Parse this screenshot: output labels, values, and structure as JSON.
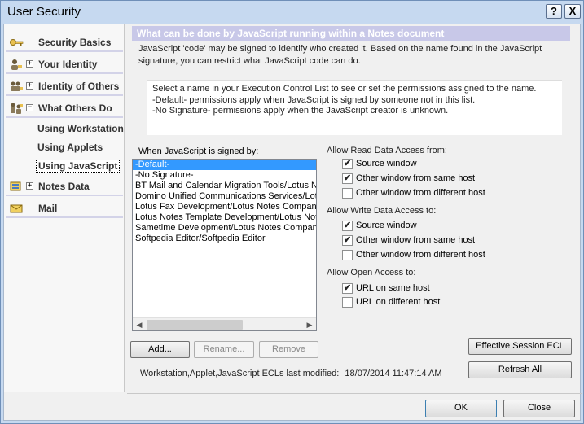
{
  "window": {
    "title": "User Security",
    "help_glyph": "?",
    "close_glyph": "X"
  },
  "sidebar": {
    "items": [
      {
        "label": "Security Basics",
        "icon": "key-icon"
      },
      {
        "label": "Your Identity",
        "icon": "person-icon",
        "expander": "+"
      },
      {
        "label": "Identity of Others",
        "icon": "people-icon",
        "expander": "+"
      },
      {
        "label": "What Others Do",
        "icon": "workers-icon",
        "expander": "−"
      },
      {
        "label": "Notes Data",
        "icon": "database-icon",
        "expander": "+"
      },
      {
        "label": "Mail",
        "icon": "envelope-icon"
      }
    ],
    "subitems": [
      {
        "label": "Using Workstation"
      },
      {
        "label": "Using Applets"
      },
      {
        "label": "Using JavaScript"
      }
    ]
  },
  "main": {
    "header": "What can be done by JavaScript running within a Notes document",
    "intro_line1": "JavaScript 'code' may be signed to identify who created it.  Based on the name found in the JavaScript",
    "intro_line2": "signature, you can restrict what JavaScript code can do.",
    "info_line1": "Select a name in your Execution Control List to see or set the permissions assigned to the name.",
    "info_line2": "-Default- permissions apply when JavaScript is signed by someone not in this list.",
    "info_line3": "-No Signature- permissions apply when the JavaScript creator is unknown.",
    "signed_label": "When JavaScript is signed by:",
    "ecl_items": [
      "-Default-",
      "-No Signature-",
      "BT Mail and Calendar Migration Tools/Lotus Notes",
      "Domino Unified Communications Services/Lotus Notes",
      "Lotus Fax Development/Lotus Notes Companion",
      "Lotus Notes Template Development/Lotus Notes",
      "Sametime Development/Lotus Notes Companion",
      "Softpedia Editor/Softpedia Editor"
    ],
    "add_button": "Add...",
    "rename_button": "Rename...",
    "remove_button": "Remove",
    "read_label": "Allow Read Data Access from:",
    "write_label": "Allow Write Data Access to:",
    "open_label": "Allow Open Access to:",
    "read_source": {
      "label": "Source window",
      "checked": "✔"
    },
    "read_same": {
      "label": "Other window from same host",
      "checked": "✔"
    },
    "read_diff": {
      "label": "Other window from different host",
      "checked": ""
    },
    "write_source": {
      "label": "Source window",
      "checked": "✔"
    },
    "write_same": {
      "label": "Other window from same host",
      "checked": "✔"
    },
    "write_diff": {
      "label": "Other window from different host",
      "checked": ""
    },
    "open_same": {
      "label": "URL on same host",
      "checked": "✔"
    },
    "open_diff": {
      "label": "URL on different host",
      "checked": ""
    },
    "effective_button": "Effective Session ECL",
    "refresh_button": "Refresh All",
    "modified_label": "Workstation,Applet,JavaScript ECLs last modified:",
    "modified_value": "18/07/2014 11:47:14 AM"
  },
  "footer": {
    "ok": "OK",
    "close": "Close"
  },
  "colors": {
    "header_bg": "#c8c8e8",
    "selection": "#3399ff",
    "window_frame": "#c6d9f0"
  }
}
